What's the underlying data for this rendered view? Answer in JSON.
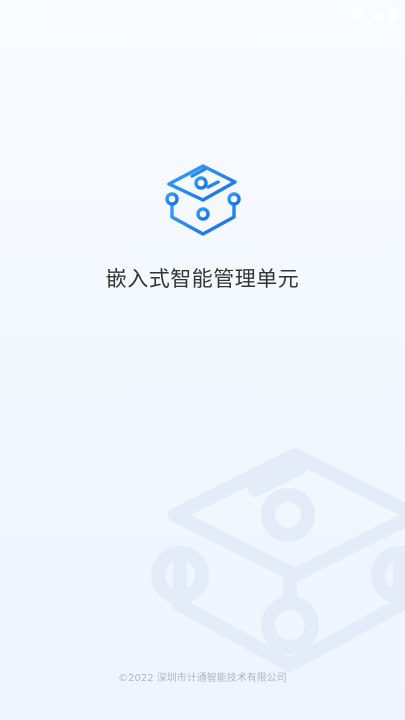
{
  "status_bar": {
    "time": "2:50",
    "icons": [
      "wifi-icon",
      "cell-signal-icon",
      "battery-icon"
    ]
  },
  "app": {
    "title": "嵌入式智能管理单元",
    "logo_icon": "circuit-box-logo-icon",
    "watermark_icon": "circuit-box-watermark-icon"
  },
  "footer": {
    "copyright": "©2022 深圳市计通智能技术有限公司"
  },
  "colors": {
    "logo_gradient_start": "#2f8df4",
    "logo_gradient_end": "#1a6fe0",
    "title_text": "#333333",
    "background_top": "#f8fbff",
    "background_bottom": "#eef5ff",
    "watermark": "#e3ecf8",
    "copyright_text": "#aab6c8"
  }
}
